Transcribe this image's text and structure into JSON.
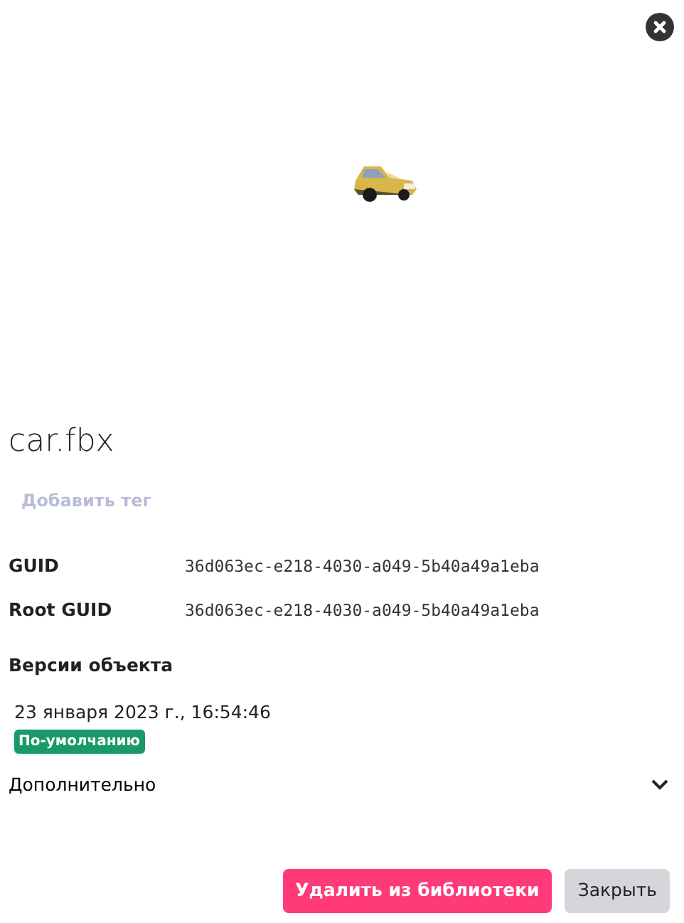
{
  "title": "car.fbx",
  "add_tag": "Добавить тег",
  "properties": [
    {
      "label": "GUID",
      "value": "36d063ec-e218-4030-a049-5b40a49a1eba"
    },
    {
      "label": "Root GUID",
      "value": "36d063ec-e218-4030-a049-5b40a49a1eba"
    }
  ],
  "versions_heading": "Версии объекта",
  "versions": [
    {
      "date": "23 января 2023 г., 16:54:46",
      "badge": "По-умолчанию"
    }
  ],
  "more": {
    "label": "Дополнительно",
    "expanded": false
  },
  "buttons": [
    {
      "label": "Удалить из библиотеки",
      "kind": "danger"
    },
    {
      "label": "Закрыть",
      "kind": "secondary"
    }
  ]
}
